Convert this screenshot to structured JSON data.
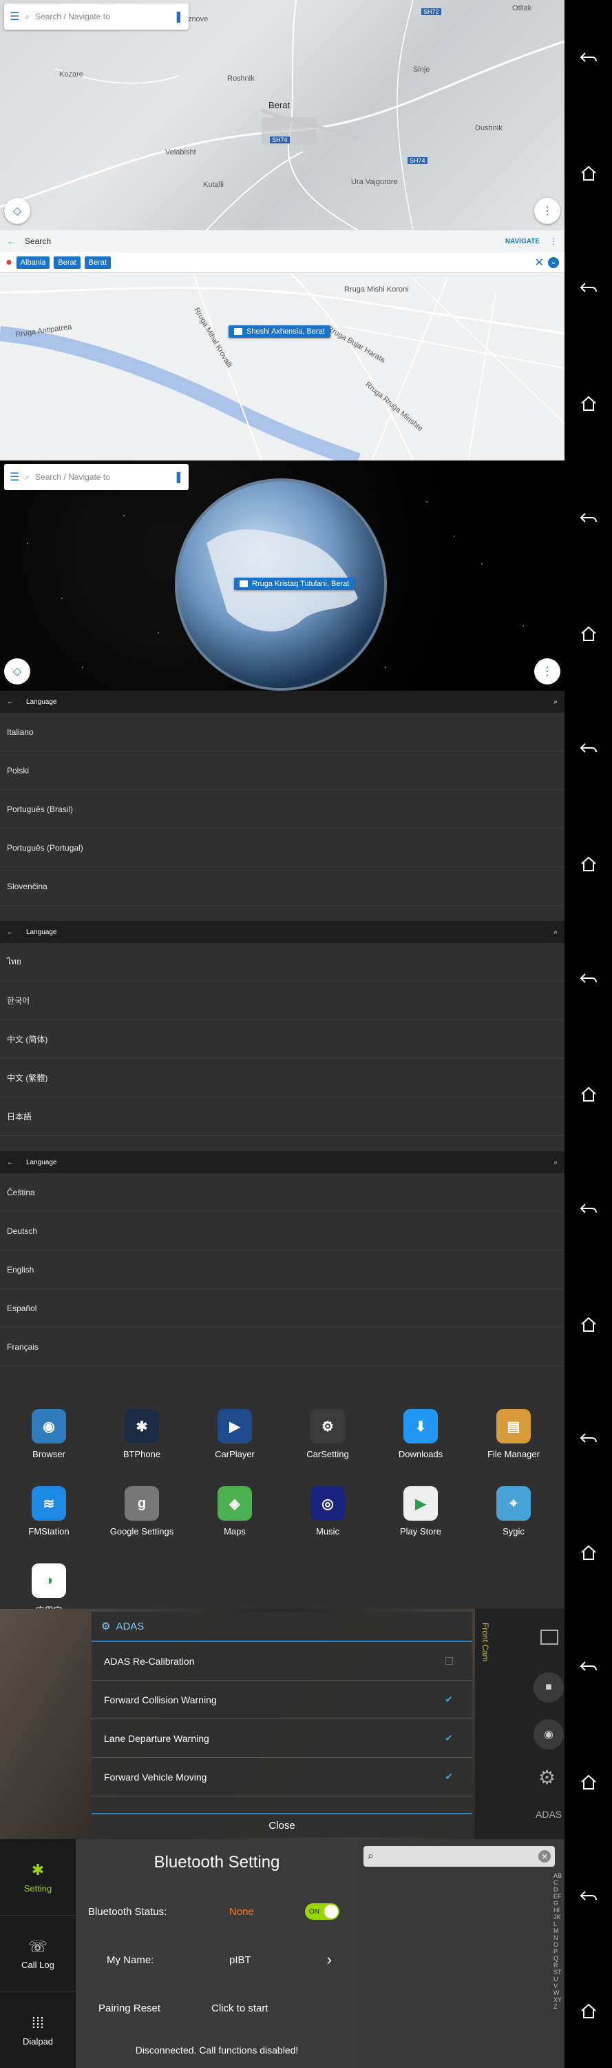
{
  "nav_icons": [
    "back-icon",
    "home-icon"
  ],
  "map1": {
    "search_placeholder": "Search / Navigate to",
    "labels": [
      "Berat",
      "Uznove",
      "SH74",
      "SH72",
      "SH74",
      "Otllak",
      "Kozare",
      "Roshnik",
      "Velabisht",
      "Sinje",
      "Ura Vajgurore",
      "Kutalli",
      "Dushnik"
    ]
  },
  "map2": {
    "title": "Search",
    "navigate": "NAVIGATE",
    "chips": [
      "Albania",
      "Berat",
      "Berat"
    ],
    "streets": [
      "Rruga Antipatrea",
      "Rruga Bujar Harata",
      "Rruga Mihal Krovalli",
      "Rruga Mishi Koroni",
      "Rruga Rruga Mirishte"
    ],
    "pin": "Sheshi Axhensia, Berat"
  },
  "globe": {
    "search_placeholder": "Search / Navigate to",
    "pin": "Rruga Kristaq Tutulani, Berat"
  },
  "lang1": {
    "title": "Language",
    "items": [
      "Italiano",
      "Polski",
      "Português (Brasil)",
      "Português (Portugal)",
      "Slovenčina"
    ]
  },
  "lang2": {
    "title": "Language",
    "items": [
      "ไทย",
      "한국어",
      "中文 (简体)",
      "中文 (繁體)",
      "日本語"
    ]
  },
  "lang3": {
    "title": "Language",
    "items": [
      "Čeština",
      "Deutsch",
      "English",
      "Español",
      "Français"
    ]
  },
  "apps": [
    {
      "name": "Browser",
      "color": "#2f7dbf",
      "glyph": "◉"
    },
    {
      "name": "BTPhone",
      "color": "#1b2c44",
      "glyph": "✱"
    },
    {
      "name": "CarPlayer",
      "color": "#1f4a8c",
      "glyph": "▶"
    },
    {
      "name": "CarSetting",
      "color": "#3b3b3b",
      "glyph": "⚙"
    },
    {
      "name": "Downloads",
      "color": "#2196f3",
      "glyph": "⬇"
    },
    {
      "name": "File Manager",
      "color": "#d89b3c",
      "glyph": "▤"
    },
    {
      "name": "FMStation",
      "color": "#1e88e5",
      "glyph": "≋"
    },
    {
      "name": "Google Settings",
      "color": "#777",
      "glyph": "g"
    },
    {
      "name": "Maps",
      "color": "#4caf50",
      "glyph": "◈"
    },
    {
      "name": "Music",
      "color": "#1a237e",
      "glyph": "◎"
    },
    {
      "name": "Play Store",
      "color": "#eeeeee",
      "glyph": "▶"
    },
    {
      "name": "Sygic",
      "color": "#4aa3d6",
      "glyph": "⌖"
    },
    {
      "name": "应用宝",
      "color": "#ffffff",
      "glyph": "◑"
    }
  ],
  "adas": {
    "title": "ADAS",
    "rows": [
      {
        "label": "ADAS Re-Calibration",
        "checked": false
      },
      {
        "label": "Forward Collision Warning",
        "checked": true
      },
      {
        "label": "Lane Departure Warning",
        "checked": true
      },
      {
        "label": "Forward Vehicle Moving",
        "checked": true
      }
    ],
    "close": "Close",
    "side_label": "Front Cam",
    "adas_label": "ADAS"
  },
  "bt": {
    "tabs": [
      "Setting",
      "Call Log",
      "Dialpad"
    ],
    "title": "Bluetooth Setting",
    "status_label": "Bluetooth Status:",
    "status_value": "None",
    "toggle": "ON",
    "name_label": "My Name:",
    "name_value": "pIBT",
    "reset_label": "Pairing Reset",
    "reset_action": "Click to start",
    "footer": "Disconnected. Call functions disabled!",
    "alphabet": "ABCDEFGHIJKLMNOPQRSTUVWXYZ",
    "colors": {
      "status": "#ff7a1a",
      "toggle": "#9bd600"
    }
  }
}
